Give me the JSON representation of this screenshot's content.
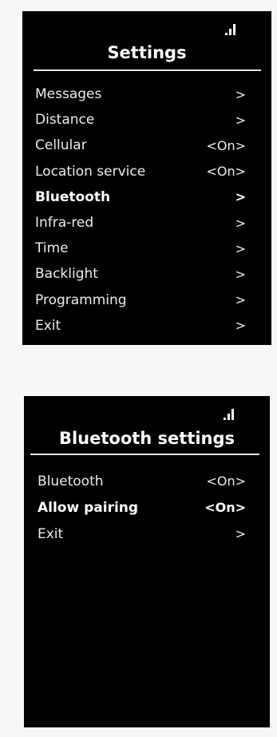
{
  "screens": [
    {
      "title": "Settings",
      "items": [
        {
          "label": "Messages",
          "value": ">"
        },
        {
          "label": "Distance",
          "value": ">"
        },
        {
          "label": "Cellular",
          "value": "<On>"
        },
        {
          "label": "Location service",
          "value": "<On>"
        },
        {
          "label": "Bluetooth",
          "value": ">",
          "selected": true
        },
        {
          "label": "Infra-red",
          "value": ">"
        },
        {
          "label": "Time",
          "value": ">"
        },
        {
          "label": "Backlight",
          "value": ">"
        },
        {
          "label": "Programming",
          "value": ">"
        },
        {
          "label": "Exit",
          "value": ">"
        }
      ]
    },
    {
      "title": "Bluetooth settings",
      "items": [
        {
          "label": "Bluetooth",
          "value": "<On>"
        },
        {
          "label": "Allow pairing",
          "value": "<On>",
          "selected": true
        },
        {
          "label": "Exit",
          "value": ">"
        }
      ]
    }
  ],
  "icons": {
    "signal": "signal-strength-icon"
  },
  "colors": {
    "screen_bg": "#000000",
    "page_bg": "#f7f7f7",
    "text": "#ffffff"
  }
}
